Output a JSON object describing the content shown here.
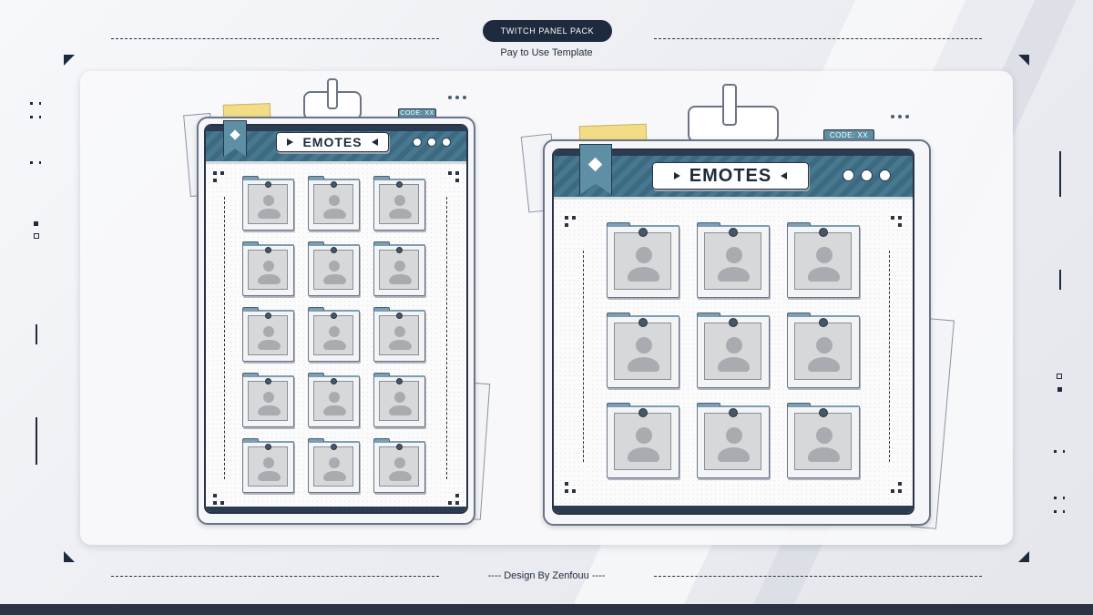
{
  "header": {
    "badge": "TWITCH PANEL PACK",
    "subtitle": "Pay to Use Template"
  },
  "footer": {
    "credit": "---- Design By Zenfouu ----"
  },
  "panels": [
    {
      "title": "EMOTES",
      "code": "CODE: XX",
      "rows": 5,
      "cols": 3
    },
    {
      "title": "EMOTES",
      "code": "CODE: XX",
      "rows": 3,
      "cols": 3
    }
  ],
  "icons": {
    "bookmark": "bookmark-diamond-icon",
    "emote_slot": "user-placeholder-icon",
    "window_dots": "three-dots-icon"
  },
  "colors": {
    "header_teal": "#3c6a80",
    "navy": "#1e2a3e",
    "sticky_note": "#f2dc86",
    "placeholder_gray": "#d7d8da"
  }
}
